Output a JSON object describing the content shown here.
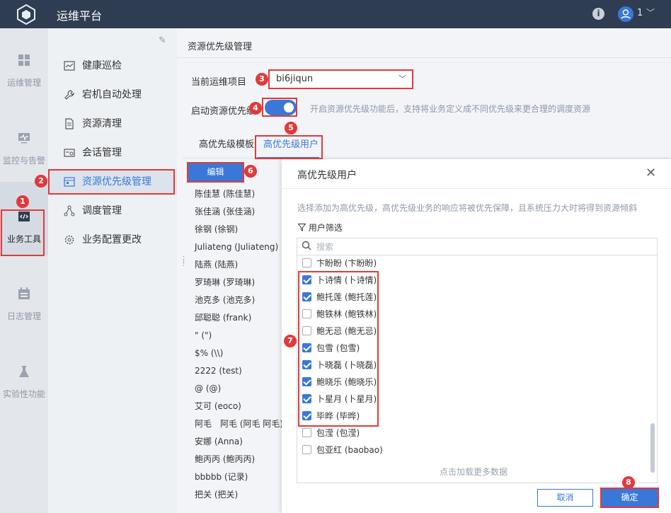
{
  "app": {
    "title": "运维平台",
    "user": "1"
  },
  "rail": [
    {
      "label": "运维管理",
      "icon": "grid-icon"
    },
    {
      "label": "监控与告警",
      "icon": "monitor-icon"
    },
    {
      "label": "业务工具",
      "icon": "code-icon",
      "active": true
    },
    {
      "label": "日志管理",
      "icon": "calendar-icon"
    },
    {
      "label": "实验性功能",
      "icon": "flask-icon"
    }
  ],
  "menu": [
    {
      "label": "健康巡检",
      "icon": "chart-icon"
    },
    {
      "label": "宕机自动处理",
      "icon": "wrench-icon"
    },
    {
      "label": "资源清理",
      "icon": "document-icon"
    },
    {
      "label": "会话管理",
      "icon": "session-icon"
    },
    {
      "label": "资源优先级管理",
      "icon": "priority-icon",
      "active": true
    },
    {
      "label": "调度管理",
      "icon": "nodes-icon"
    },
    {
      "label": "业务配置更改",
      "icon": "settings-icon"
    }
  ],
  "page": {
    "title": "资源优先级管理",
    "project_label": "当前运维项目",
    "project_value": "bi6jiqun",
    "enable_label": "启动资源优先级",
    "enable_on": true,
    "enable_hint": "开启资源优先级功能后，支持将业务定义成不同优先级来更合理的调度资源",
    "tabs": [
      "高优先级模板",
      "高优先级用户"
    ],
    "active_tab": 1,
    "edit_label": "编辑",
    "users": [
      "陈佳慧 (陈佳慧)",
      "张佳涵 (张佳涵)",
      "徐钢 (徐钢)",
      "Juliateng (Juliateng)",
      "陆燕 (陆燕)",
      "罗琦琳 (罗琦琳)",
      "池克多 (池克多)",
      "邱聪聪 (frank)",
      "\" (\")",
      "$% (\\\\)",
      "2222 (test)",
      "@ (@)",
      "艾可 (eoco)",
      "阿毛　阿毛 (阿毛 阿毛)",
      "安娜 (Anna)",
      "鲍丙丙 (鲍丙丙)",
      "bbbbb (记录)",
      "把关 (把关)"
    ]
  },
  "panel": {
    "title": "高优先级用户",
    "description": "选择添加为高优先级，高优先级业务的响应将被优先保障，且系统压力大时将得到资源倾斜",
    "filter_label": "用户筛选",
    "search_placeholder": "搜索",
    "options": [
      {
        "label": "卞盼盼 (卞盼盼)",
        "checked": false
      },
      {
        "label": "卜诗情 (卜诗情)",
        "checked": true
      },
      {
        "label": "鲍托莲 (鲍托莲)",
        "checked": true
      },
      {
        "label": "鲍铁林 (鲍铁林)",
        "checked": false
      },
      {
        "label": "鲍无忌 (鲍无忌)",
        "checked": false
      },
      {
        "label": "包雪 (包雪)",
        "checked": true
      },
      {
        "label": "卜晓磊 (卜晓磊)",
        "checked": true
      },
      {
        "label": "鲍晓乐 (鲍晓乐)",
        "checked": true
      },
      {
        "label": "卜星月 (卜星月)",
        "checked": true
      },
      {
        "label": "毕晔 (毕晔)",
        "checked": true
      },
      {
        "label": "包滢 (包滢)",
        "checked": false
      },
      {
        "label": "包亚红 (baobao)",
        "checked": false
      }
    ],
    "load_more": "点击加载更多数据",
    "cancel_label": "取消",
    "ok_label": "确定"
  },
  "annotations": [
    "1",
    "2",
    "3",
    "4",
    "5",
    "6",
    "7",
    "8"
  ],
  "colors": {
    "accent": "#3a78d8",
    "annotation": "#e03a3a",
    "topbar": "#2f3d52"
  }
}
